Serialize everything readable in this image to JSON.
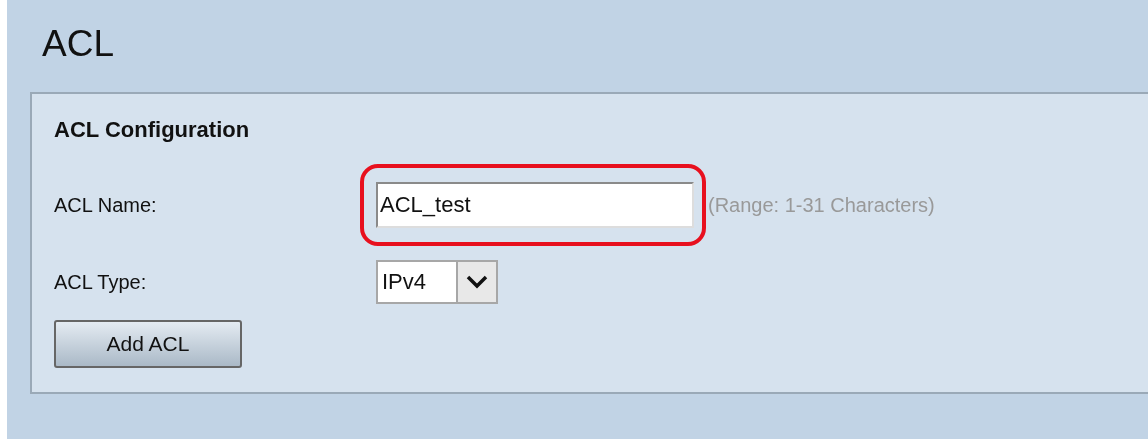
{
  "page": {
    "title": "ACL"
  },
  "section": {
    "title": "ACL Configuration",
    "name_field": {
      "label": "ACL Name:",
      "value": "ACL_test",
      "highlighted": true,
      "hint": "(Range: 1-31 Characters)"
    },
    "type_field": {
      "label": "ACL Type:",
      "value": "IPv4"
    },
    "buttons": [
      "Add ACL"
    ]
  }
}
